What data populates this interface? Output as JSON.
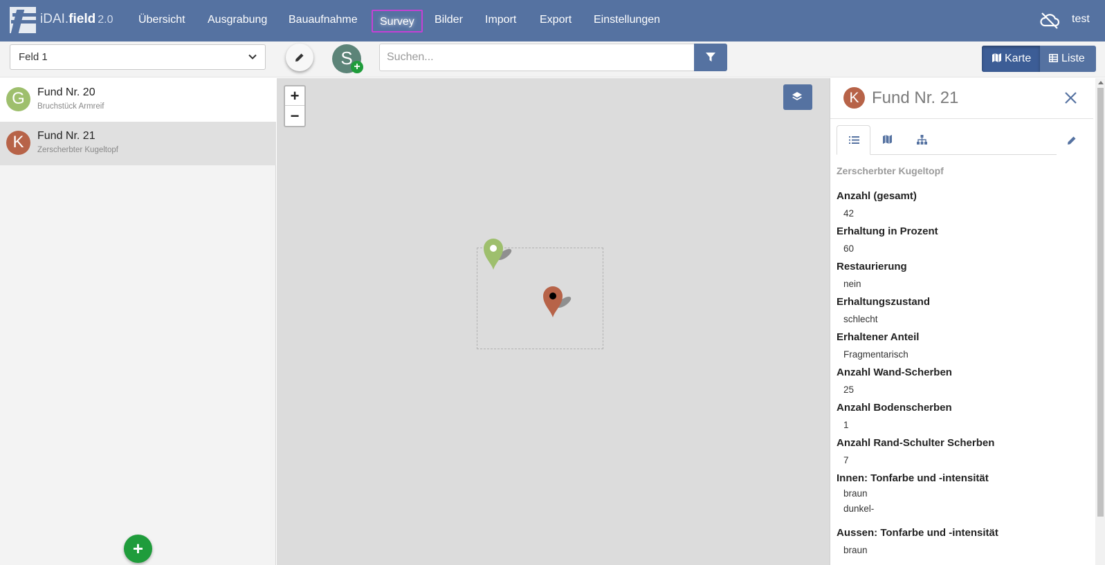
{
  "app": {
    "brand_prefix": "iDAI.",
    "brand_main": "field",
    "brand_version": "2.0",
    "user": "test"
  },
  "nav": {
    "items": [
      {
        "label": "Übersicht",
        "active": false
      },
      {
        "label": "Ausgrabung",
        "active": false
      },
      {
        "label": "Bauaufnahme",
        "active": false
      },
      {
        "label": "Survey",
        "active": true
      },
      {
        "label": "Bilder",
        "active": false
      },
      {
        "label": "Import",
        "active": false
      },
      {
        "label": "Export",
        "active": false
      },
      {
        "label": "Einstellungen",
        "active": false
      }
    ]
  },
  "toolbar": {
    "operation_select": "Feld 1",
    "create_avatar_letter": "S",
    "search_placeholder": "Suchen...",
    "view_map_label": "Karte",
    "view_list_label": "Liste"
  },
  "list": {
    "items": [
      {
        "letter": "G",
        "title": "Fund Nr. 20",
        "subtitle": "Bruchstück Armreif",
        "color": "#9ebf6d"
      },
      {
        "letter": "K",
        "title": "Fund Nr. 21",
        "subtitle": "Zerscherbter Kugeltopf",
        "color": "#b76348"
      }
    ]
  },
  "map": {
    "zoom_in": "+",
    "zoom_out": "−",
    "markers": [
      {
        "name": "Fund Nr. 20",
        "color": "#9ebf6d"
      },
      {
        "name": "Fund Nr. 21",
        "color": "#b76348",
        "selected": true
      }
    ]
  },
  "sidebar": {
    "avatar_letter": "K",
    "title": "Fund Nr. 21",
    "short_description": "Zerscherbter Kugeltopf",
    "fields": [
      {
        "label": "Anzahl (gesamt)",
        "values": [
          "42"
        ]
      },
      {
        "label": "Erhaltung in Prozent",
        "values": [
          "60"
        ]
      },
      {
        "label": "Restaurierung",
        "values": [
          "nein"
        ]
      },
      {
        "label": "Erhaltungszustand",
        "values": [
          "schlecht"
        ]
      },
      {
        "label": "Erhaltener Anteil",
        "values": [
          "Fragmentarisch"
        ]
      },
      {
        "label": "Anzahl Wand-Scherben",
        "values": [
          "25"
        ]
      },
      {
        "label": "Anzahl Bodenscherben",
        "values": [
          "1"
        ]
      },
      {
        "label": "Anzahl Rand-Schulter Scherben",
        "values": [
          "7"
        ]
      },
      {
        "label": "Innen: Tonfarbe und -intensität",
        "values": [
          "braun",
          "dunkel-"
        ]
      },
      {
        "label": "Aussen: Tonfarbe und -intensität",
        "values": [
          "braun"
        ]
      }
    ]
  },
  "colors": {
    "navbar": "#5572a1",
    "accent_green": "#1f9c3b",
    "active_nav_outline": "#c541d5"
  }
}
